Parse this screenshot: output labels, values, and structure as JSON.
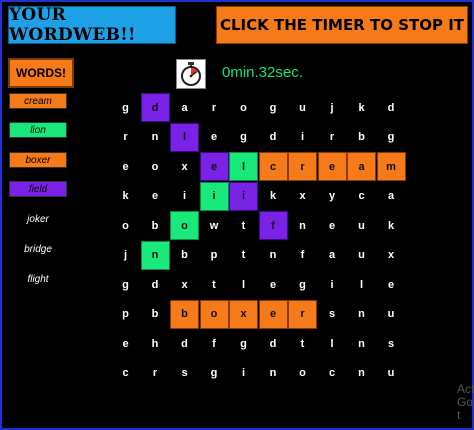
{
  "header": {
    "title": "YOUR WORDWEB!!",
    "stop_label": "CLICK THE TIMER TO STOP IT"
  },
  "words": {
    "header": "WORDS!",
    "items": [
      {
        "label": "cream",
        "color": "#f47a1a",
        "found": true
      },
      {
        "label": "lion",
        "color": "#19e87a",
        "found": true
      },
      {
        "label": "boxer",
        "color": "#f47a1a",
        "found": true
      },
      {
        "label": "field",
        "color": "#7a22e6",
        "found": true
      },
      {
        "label": "joker",
        "found": false
      },
      {
        "label": "bridge",
        "found": false
      },
      {
        "label": "flight",
        "found": false
      }
    ]
  },
  "timer": {
    "icon": "stopwatch-icon",
    "text": "0min.32sec."
  },
  "grid": {
    "rows": [
      [
        "g",
        "d",
        "a",
        "r",
        "o",
        "g",
        "u",
        "j",
        "k",
        "d"
      ],
      [
        "r",
        "n",
        "l",
        "e",
        "g",
        "d",
        "i",
        "r",
        "b",
        "g"
      ],
      [
        "e",
        "o",
        "x",
        "e",
        "l",
        "c",
        "r",
        "e",
        "a",
        "m"
      ],
      [
        "k",
        "e",
        "i",
        "i",
        "i",
        "k",
        "x",
        "y",
        "c",
        "a"
      ],
      [
        "o",
        "b",
        "o",
        "w",
        "t",
        "f",
        "n",
        "e",
        "u",
        "k"
      ],
      [
        "j",
        "n",
        "b",
        "p",
        "t",
        "n",
        "f",
        "a",
        "u",
        "x"
      ],
      [
        "g",
        "d",
        "x",
        "t",
        "l",
        "e",
        "g",
        "i",
        "l",
        "e"
      ],
      [
        "p",
        "b",
        "b",
        "o",
        "x",
        "e",
        "r",
        "s",
        "n",
        "u"
      ],
      [
        "e",
        "h",
        "d",
        "f",
        "g",
        "d",
        "t",
        "l",
        "n",
        "s"
      ],
      [
        "c",
        "r",
        "s",
        "g",
        "i",
        "n",
        "o",
        "c",
        "n",
        "u"
      ]
    ],
    "highlights": [
      {
        "r": 0,
        "c": 1,
        "color": "purple"
      },
      {
        "r": 1,
        "c": 2,
        "color": "purple"
      },
      {
        "r": 2,
        "c": 3,
        "color": "purple"
      },
      {
        "r": 3,
        "c": 4,
        "color": "purple"
      },
      {
        "r": 4,
        "c": 5,
        "color": "purple"
      },
      {
        "r": 2,
        "c": 4,
        "color": "green"
      },
      {
        "r": 3,
        "c": 3,
        "color": "green"
      },
      {
        "r": 4,
        "c": 2,
        "color": "green"
      },
      {
        "r": 5,
        "c": 1,
        "color": "green"
      },
      {
        "r": 2,
        "c": 5,
        "color": "orange"
      },
      {
        "r": 2,
        "c": 6,
        "color": "orange"
      },
      {
        "r": 2,
        "c": 7,
        "color": "orange"
      },
      {
        "r": 2,
        "c": 8,
        "color": "orange"
      },
      {
        "r": 2,
        "c": 9,
        "color": "orange"
      },
      {
        "r": 7,
        "c": 2,
        "color": "orange"
      },
      {
        "r": 7,
        "c": 3,
        "color": "orange"
      },
      {
        "r": 7,
        "c": 4,
        "color": "orange"
      },
      {
        "r": 7,
        "c": 5,
        "color": "orange"
      },
      {
        "r": 7,
        "c": 6,
        "color": "orange"
      }
    ]
  },
  "watermark": {
    "line1": "Act",
    "line2": "Go t"
  }
}
